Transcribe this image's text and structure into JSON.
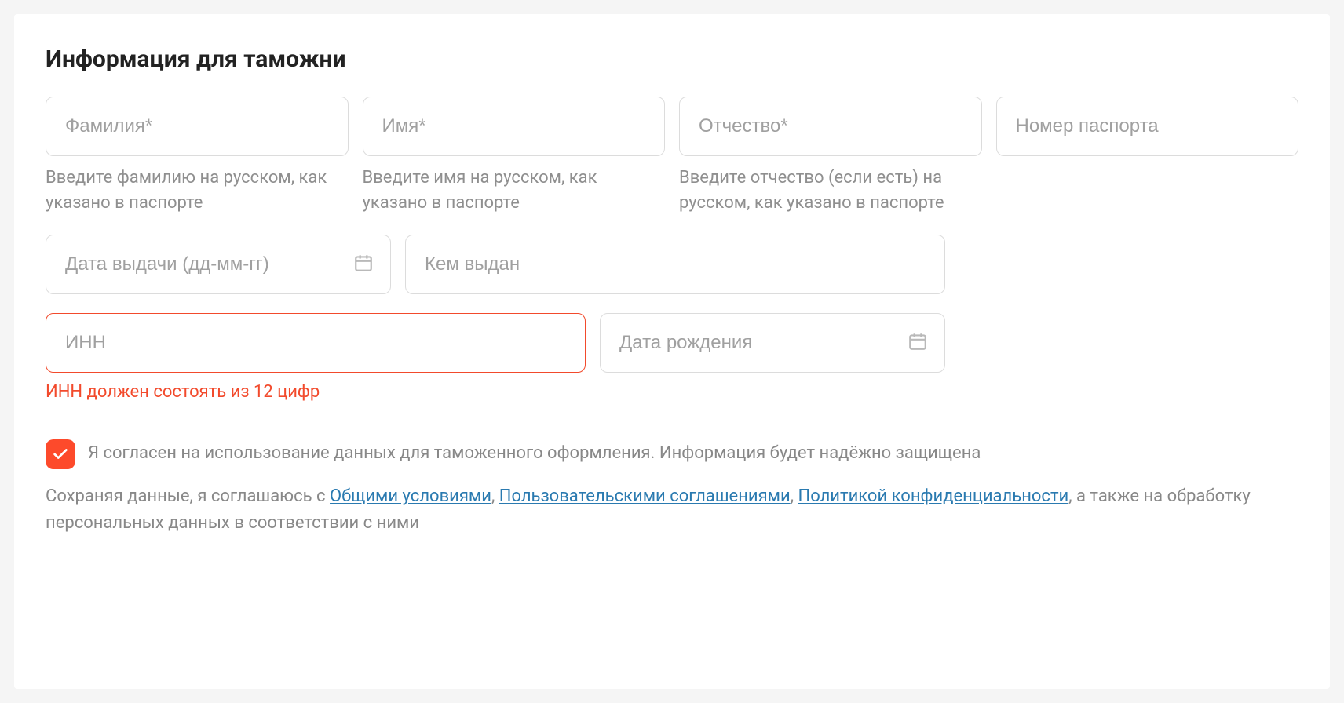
{
  "section_title": "Информация для таможни",
  "fields": {
    "lastname": {
      "placeholder": "Фамилия*",
      "hint": "Введите фамилию на русском, как указано в паспорте",
      "value": ""
    },
    "firstname": {
      "placeholder": "Имя*",
      "hint": "Введите имя на русском, как указано в паспорте",
      "value": ""
    },
    "middlename": {
      "placeholder": "Отчество*",
      "hint": "Введите отчество (если есть) на русском, как указано в паспорте",
      "value": ""
    },
    "passport_number": {
      "placeholder": "Номер паспорта",
      "value": ""
    },
    "issue_date": {
      "placeholder": "Дата выдачи (дд-мм-гг)",
      "value": ""
    },
    "issued_by": {
      "placeholder": "Кем выдан",
      "value": ""
    },
    "inn": {
      "placeholder": "ИНН",
      "value": "",
      "error": "ИНН должен состоять из 12 цифр"
    },
    "birth_date": {
      "placeholder": "Дата рождения",
      "value": ""
    }
  },
  "consent": {
    "checked": true,
    "text": "Я согласен на использование данных для таможенного оформления. Информация будет надёжно защищена"
  },
  "legal": {
    "prefix": "Сохраняя данные, я соглашаюсь с ",
    "link_terms": "Общими условиями",
    "sep1": ", ",
    "link_agreements": "Пользовательскими соглашениями",
    "sep2": ", ",
    "link_privacy": "Политикой конфиденциальности",
    "suffix": ", а также на обработку персональных данных в соответствии с ними"
  }
}
